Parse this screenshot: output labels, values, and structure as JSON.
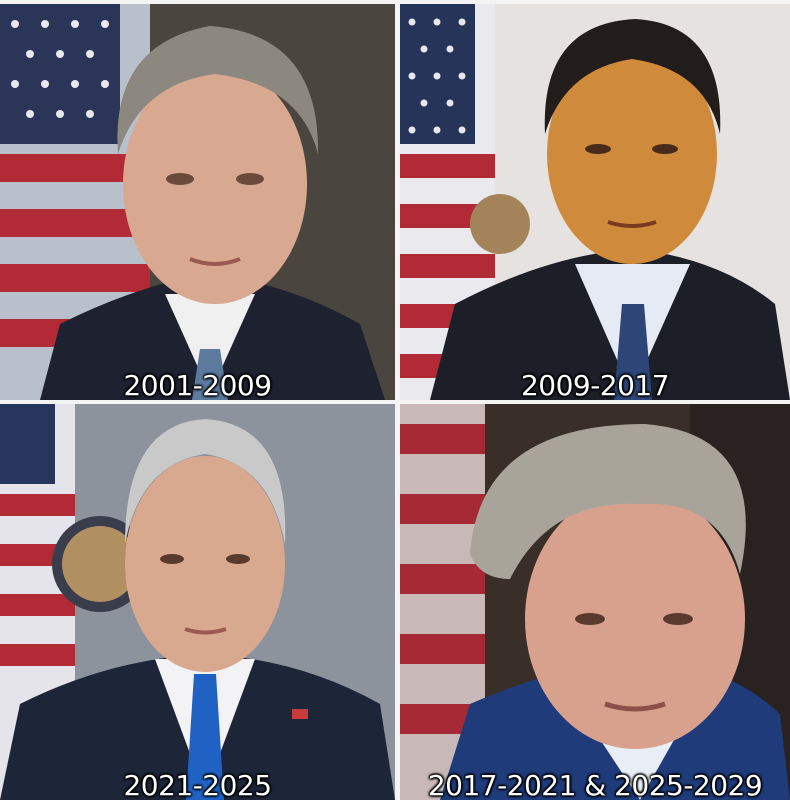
{
  "panels": [
    {
      "caption": "2001-2009"
    },
    {
      "caption": "2009-2017"
    },
    {
      "caption": "2021-2025"
    },
    {
      "caption": "2017-2021 & 2025-2029"
    }
  ]
}
